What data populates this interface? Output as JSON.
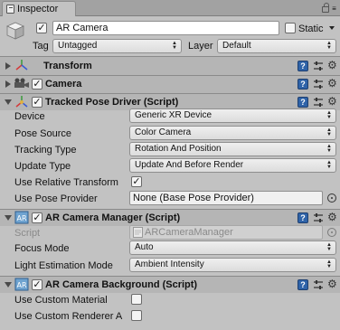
{
  "tab": {
    "label": "Inspector"
  },
  "header": {
    "name_value": "AR Camera",
    "static_label": "Static",
    "tag_label": "Tag",
    "tag_value": "Untagged",
    "layer_label": "Layer",
    "layer_value": "Default"
  },
  "transform": {
    "title": "Transform"
  },
  "camera": {
    "title": "Camera"
  },
  "tracked_pose_driver": {
    "title": "Tracked Pose Driver (Script)",
    "device_label": "Device",
    "device_value": "Generic XR Device",
    "pose_source_label": "Pose Source",
    "pose_source_value": "Color Camera",
    "tracking_type_label": "Tracking Type",
    "tracking_type_value": "Rotation And Position",
    "update_type_label": "Update Type",
    "update_type_value": "Update And Before Render",
    "use_relative_transform_label": "Use Relative Transform",
    "use_pose_provider_label": "Use Pose Provider",
    "use_pose_provider_value": "None (Base Pose Provider)"
  },
  "ar_camera_manager": {
    "title": "AR Camera Manager (Script)",
    "script_label": "Script",
    "script_value": "ARCameraManager",
    "focus_mode_label": "Focus Mode",
    "focus_mode_value": "Auto",
    "light_estimation_label": "Light Estimation Mode",
    "light_estimation_value": "Ambient Intensity"
  },
  "ar_camera_background": {
    "title": "AR Camera Background (Script)",
    "use_custom_material_label": "Use Custom Material",
    "use_custom_renderer_label": "Use Custom Renderer A"
  },
  "colors": {
    "help_icon": "#2f63a8",
    "panel_bg": "#c2c2c2"
  }
}
